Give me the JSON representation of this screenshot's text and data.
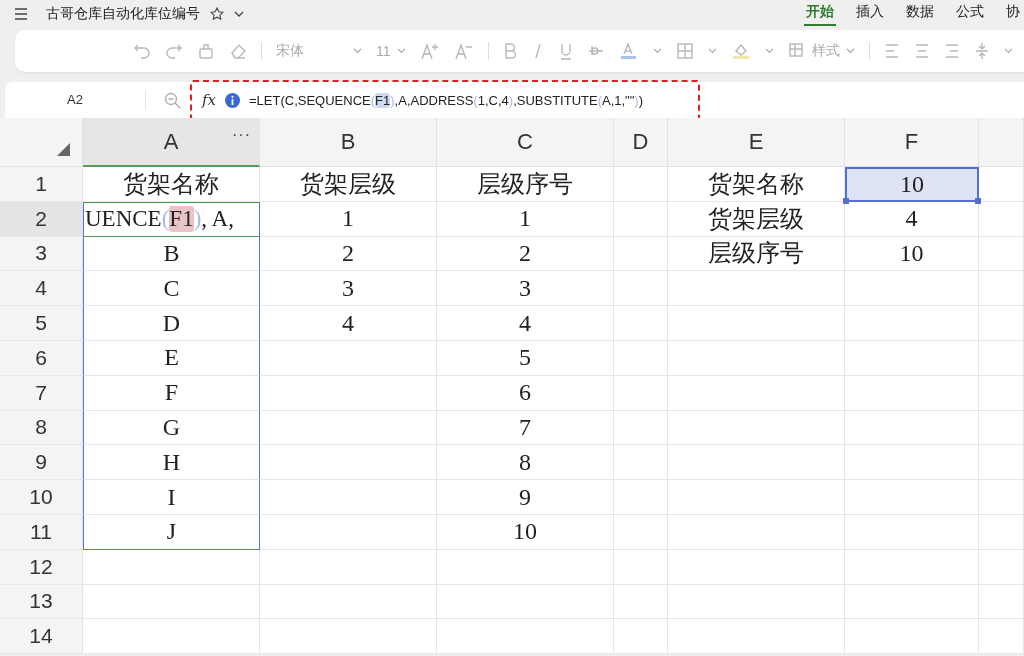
{
  "title_bar": {
    "title": "古哥仓库自动化库位编号"
  },
  "tabs": [
    {
      "label": "开始",
      "selected": true
    },
    {
      "label": "插入",
      "selected": false
    },
    {
      "label": "数据",
      "selected": false
    },
    {
      "label": "公式",
      "selected": false
    },
    {
      "label": "协",
      "selected": false
    }
  ],
  "toolbar": {
    "font": "宋体",
    "size": "11",
    "style_label": "样式"
  },
  "formula_bar": {
    "name_box": "A2",
    "fx_label": "fx",
    "segments": [
      {
        "kind": "text",
        "text": "=LET(C,SEQUENCE"
      },
      {
        "kind": "paren",
        "text": "("
      },
      {
        "kind": "ref",
        "text": "F1"
      },
      {
        "kind": "paren",
        "text": ")"
      },
      {
        "kind": "text",
        "text": ",A,ADDRESS"
      },
      {
        "kind": "paren",
        "text": "("
      },
      {
        "kind": "text",
        "text": "1,C,4"
      },
      {
        "kind": "paren",
        "text": ")"
      },
      {
        "kind": "text",
        "text": ",SUBSTITUTE"
      },
      {
        "kind": "paren",
        "text": "("
      },
      {
        "kind": "text",
        "text": "A,1,\"\""
      },
      {
        "kind": "paren",
        "text": ")"
      },
      {
        "kind": "text",
        "text": ")"
      }
    ]
  },
  "columns": [
    {
      "label": "A",
      "selected": true,
      "more": "···"
    },
    {
      "label": "B",
      "selected": false
    },
    {
      "label": "C",
      "selected": false
    },
    {
      "label": "D",
      "selected": false
    },
    {
      "label": "E",
      "selected": false
    },
    {
      "label": "F",
      "selected": false
    }
  ],
  "rows": [
    {
      "number": "1",
      "selected": false,
      "cells": [
        {
          "text": "货架名称"
        },
        {
          "text": "货架层级"
        },
        {
          "text": "层级序号"
        },
        null,
        {
          "text": "货架名称"
        },
        {
          "text": "10",
          "selected": true
        }
      ]
    },
    {
      "number": "2",
      "selected": true,
      "cells": [
        {
          "kind": "editing",
          "referenced": true,
          "segments": [
            {
              "kind": "text",
              "text": "UENCE"
            },
            {
              "kind": "paren",
              "text": "("
            },
            {
              "kind": "ref",
              "text": "F1"
            },
            {
              "kind": "paren",
              "text": ")"
            },
            {
              "kind": "text",
              "text": " , A,"
            }
          ]
        },
        {
          "text": "1"
        },
        {
          "text": "1"
        },
        null,
        {
          "text": "货架层级"
        },
        {
          "text": "4"
        }
      ]
    },
    {
      "number": "3",
      "selected": false,
      "cells": [
        {
          "text": "B",
          "referenced": true
        },
        {
          "text": "2"
        },
        {
          "text": "2"
        },
        null,
        {
          "text": "层级序号"
        },
        {
          "text": "10"
        }
      ]
    },
    {
      "number": "4",
      "selected": false,
      "cells": [
        {
          "text": "C",
          "referenced": true
        },
        {
          "text": "3"
        },
        {
          "text": "3"
        }
      ]
    },
    {
      "number": "5",
      "selected": false,
      "cells": [
        {
          "text": "D",
          "referenced": true
        },
        {
          "text": "4"
        },
        {
          "text": "4"
        }
      ]
    },
    {
      "number": "6",
      "selected": false,
      "cells": [
        {
          "text": "E",
          "referenced": true
        },
        null,
        {
          "text": "5"
        }
      ]
    },
    {
      "number": "7",
      "selected": false,
      "cells": [
        {
          "text": "F",
          "referenced": true
        },
        null,
        {
          "text": "6"
        }
      ]
    },
    {
      "number": "8",
      "selected": false,
      "cells": [
        {
          "text": "G",
          "referenced": true
        },
        null,
        {
          "text": "7"
        }
      ]
    },
    {
      "number": "9",
      "selected": false,
      "cells": [
        {
          "text": "H",
          "referenced": true
        },
        null,
        {
          "text": "8"
        }
      ]
    },
    {
      "number": "10",
      "selected": false,
      "cells": [
        {
          "text": "I",
          "referenced": true
        },
        null,
        {
          "text": "9"
        }
      ]
    },
    {
      "number": "11",
      "selected": false,
      "cells": [
        {
          "text": "J",
          "referenced": true
        },
        null,
        {
          "text": "10"
        }
      ]
    },
    {
      "number": "12",
      "selected": false
    },
    {
      "number": "13",
      "selected": false
    },
    {
      "number": "14",
      "selected": false
    }
  ]
}
